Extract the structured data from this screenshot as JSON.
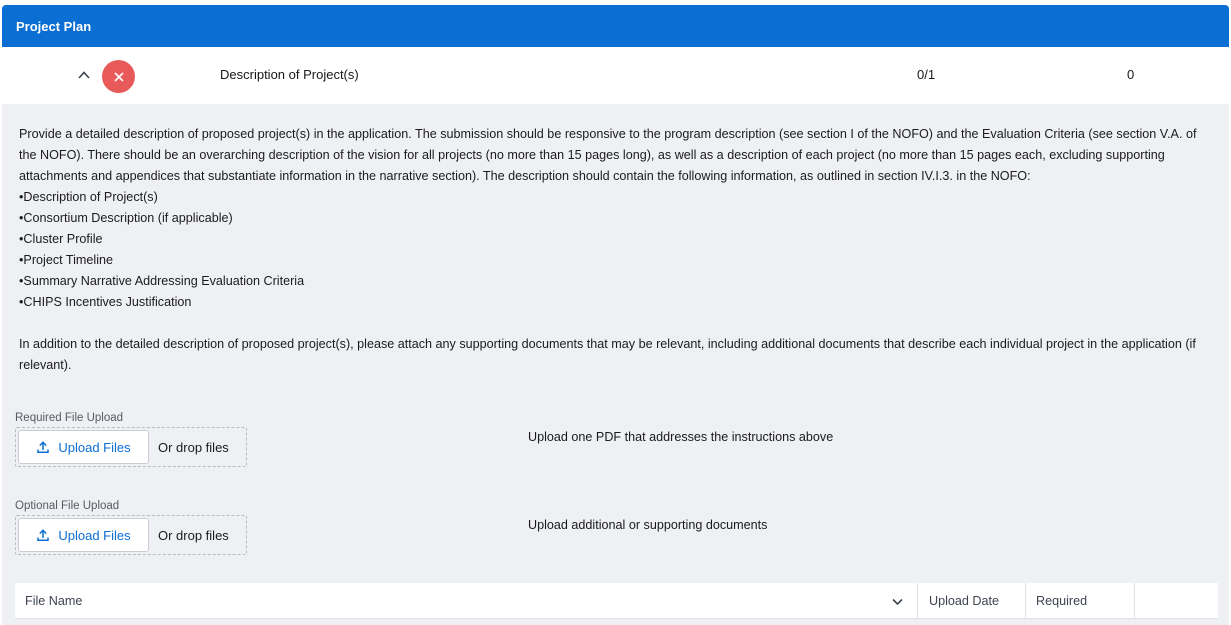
{
  "header": {
    "title": "Project Plan",
    "color": "#0b6ed3"
  },
  "row": {
    "title": "Description of Project(s)",
    "count": "0/1",
    "value": "0",
    "remove_color": "#e8595a",
    "expand_icon": "chevron-up-icon",
    "remove_icon": "close-icon"
  },
  "panel": {
    "description": "Provide a detailed description of proposed project(s) in the application. The submission should be responsive to the program description (see section I of the NOFO) and the Evaluation Criteria (see section V.A. of the NOFO). There should be an overarching description of the vision for all projects (no more than 15 pages long), as well as a description of each project (no more than 15 pages each, excluding supporting attachments and appendices that substantiate information in the narrative section). The description should contain the following information, as outlined in section IV.I.3. in the NOFO:",
    "bullets": [
      "Description of Project(s)",
      "Consortium Description (if applicable)",
      "Cluster Profile",
      "Project Timeline",
      "Summary Narrative Addressing Evaluation Criteria",
      "CHIPS Incentives Justification"
    ],
    "additional": "In addition to the detailed description of proposed project(s), please attach any supporting documents that may be relevant, including additional documents that describe each individual project in the application (if relevant)."
  },
  "uploads": {
    "required": {
      "label": "Required File Upload",
      "button": "Upload Files",
      "drop": "Or drop files",
      "hint": "Upload one PDF that addresses the instructions above"
    },
    "optional": {
      "label": "Optional File Upload",
      "button": "Upload Files",
      "drop": "Or drop files",
      "hint": "Upload additional or supporting documents"
    },
    "icon": "upload-icon"
  },
  "table": {
    "columns": [
      "File Name",
      "Upload Date",
      "Required",
      ""
    ]
  }
}
